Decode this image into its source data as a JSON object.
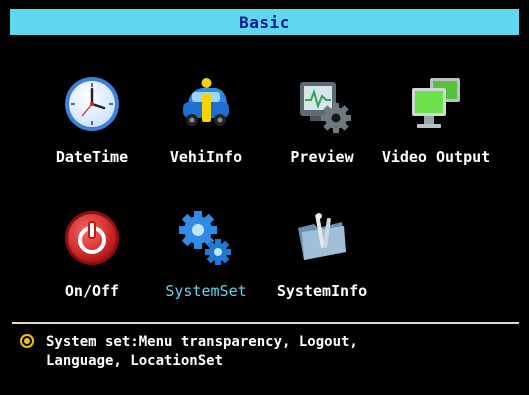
{
  "header": {
    "title": "Basic"
  },
  "menu": {
    "items": [
      {
        "label": "DateTime",
        "icon": "clock-icon"
      },
      {
        "label": "VehiInfo",
        "icon": "vehicle-info-icon"
      },
      {
        "label": "Preview",
        "icon": "preview-monitor-icon"
      },
      {
        "label": "Video Output",
        "icon": "video-output-icon"
      },
      {
        "label": "On/Off",
        "icon": "power-icon"
      },
      {
        "label": "SystemSet",
        "icon": "gears-icon",
        "selected": true
      },
      {
        "label": "SystemInfo",
        "icon": "system-info-folder-icon"
      }
    ]
  },
  "help": {
    "icon": "info-bullet-icon",
    "line1": "System set:Menu transparency, Logout,",
    "line2": "Language, LocationSet"
  },
  "colors": {
    "title_bar": "#5fd7ee",
    "title_text": "#0a1a8a",
    "background": "#000000",
    "selected_label": "#5fd7ee",
    "bullet": "#f2c200"
  }
}
